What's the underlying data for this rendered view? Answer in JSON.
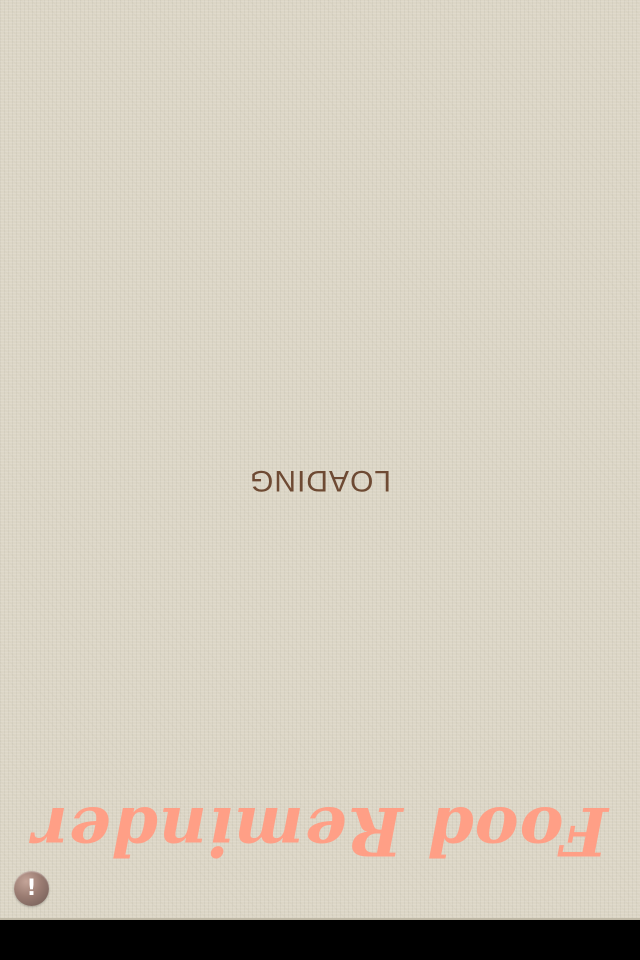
{
  "screen": {
    "loading_label": "LOADING",
    "brand_title": "Food Reminder",
    "orientation": "upside-down"
  },
  "alert_button": {
    "icon": "exclamation-icon",
    "glyph": "!"
  },
  "colors": {
    "background": "#dcd6c6",
    "loading_text": "#6e4a33",
    "brand_title": "#ff9f86",
    "bottom_bar": "#000000",
    "alert_button": "#9a7c72"
  }
}
